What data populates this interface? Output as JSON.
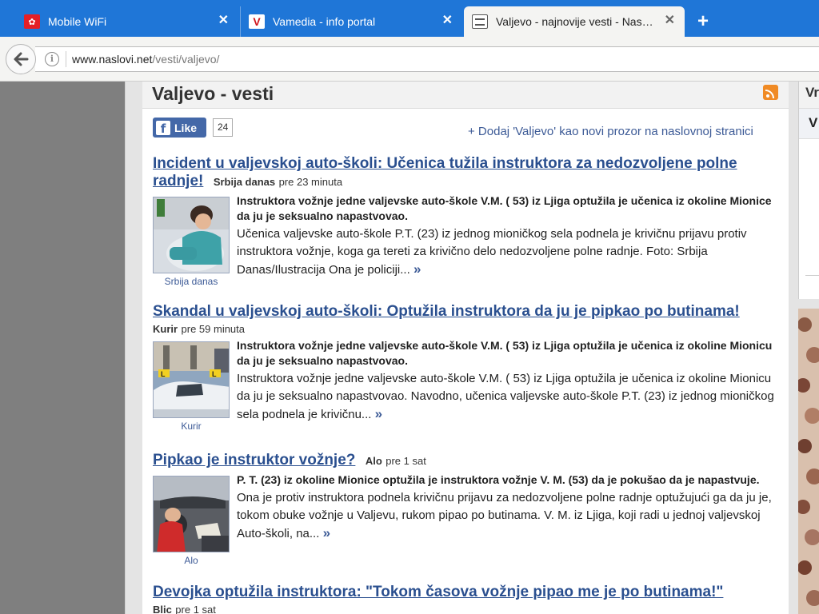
{
  "browser": {
    "tabs": [
      {
        "title": "Mobile WiFi",
        "favicon": "huawei-icon",
        "active": false
      },
      {
        "title": "Vamedia - info portal",
        "favicon": "vamedia-icon",
        "active": false
      },
      {
        "title": "Valjevo - najnovije vesti - Nas…",
        "favicon": "newspaper-icon",
        "active": true
      }
    ],
    "new_tab": "+",
    "close_glyph": "✕",
    "url_host": "www.naslovi.net",
    "url_path": "/vesti/valjevo/"
  },
  "page": {
    "title": "Valjevo - vesti",
    "like_label": "Like",
    "like_count": "24",
    "add_link": "+ Dodaj 'Valjevo' kao novi prozor na naslovnoj stranici",
    "right_panel_text_1": "Vr",
    "right_panel_text_2": "V"
  },
  "articles": [
    {
      "title": "Incident u valjevskoj auto-školi: Učenica tužila instruktora za nedozvoljene polne radnje!",
      "source": "Srbija danas",
      "time": "pre 23 minuta",
      "caption": "Srbija danas",
      "lead": "Instruktora vožnje jedne valjevske auto-škole V.M. ( 53) iz Ljiga optužila je učenica iz okoline Mionice da ju je seksualno napastvovao.",
      "text": "Učenica valjevske auto-škole P.T. (23) iz jednog mioničkog sela podnela je krivičnu prijavu protiv instruktora vožnje, koga ga tereti za krivično delo nedozvoljene polne radnje. Foto: Srbija Danas/Ilustracija Ona je policiji...",
      "more": "»"
    },
    {
      "title": "Skandal u valjevskoj auto-školi: Optužila instruktora da ju je pipkao po butinama!",
      "source": "Kurir",
      "time": "pre 59 minuta",
      "caption": "Kurir",
      "lead": "Instruktora vožnje jedne valjevske auto-škole V.M. ( 53) iz Ljiga optužila je učenica iz okoline Mionicu da ju je seksualno napastvovao.",
      "text": "Instruktora vožnje jedne valjevske auto-škole V.M. ( 53) iz Ljiga optužila je učenica iz okoline Mionicu da ju je seksualno napastvovao. Navodno, učenica valjevske auto-škole P.T. (23) iz jednog mioničkog sela podnela je krivičnu...",
      "more": "»"
    },
    {
      "title": "Pipkao je instruktor vožnje?",
      "source": "Alo",
      "time": "pre 1 sat",
      "caption": "Alo",
      "lead": "P. T. (23) iz okoline Mionice optužila je instruktora vožnje V. M. (53) da je pokušao da je napastvuje.",
      "text": "Ona je protiv instruktora podnela krivičnu prijavu za nedozvoljene polne radnje optužujući ga da ju je, tokom obuke vožnje u Valjevu, rukom pipao po butinama. V. M. iz Ljiga, koji radi u jednoj valjevskoj Auto-školi, na...",
      "more": "»"
    },
    {
      "title": "Devojka optužila instruktora: \"Tokom časova vožnje pipao me je po butinama!\"",
      "source": "Blic",
      "time": "pre 1 sat"
    }
  ]
}
